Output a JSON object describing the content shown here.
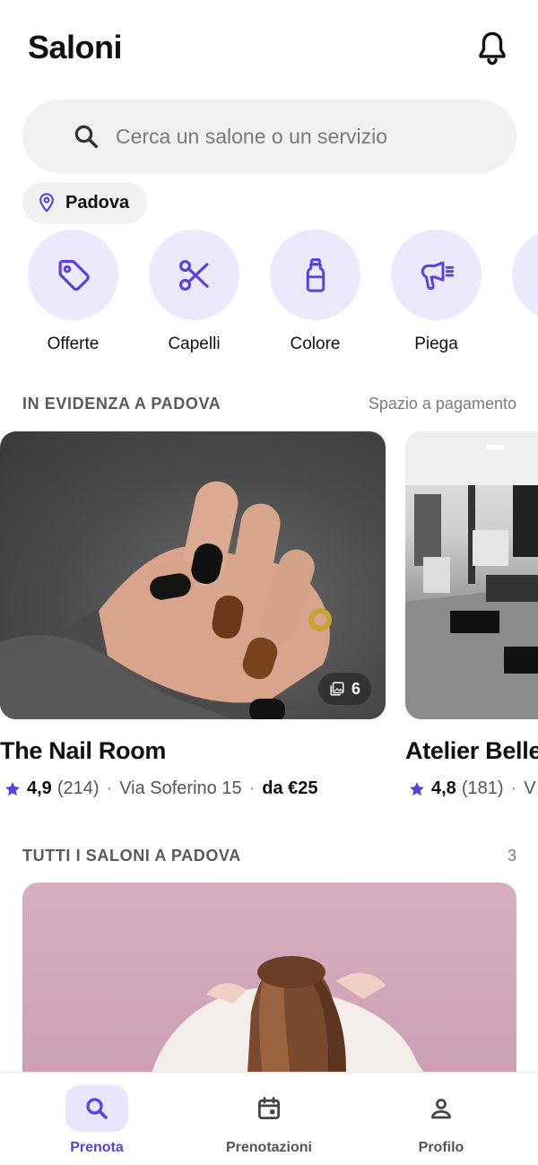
{
  "header": {
    "title": "Saloni",
    "bell_icon": "bell-icon"
  },
  "search": {
    "placeholder": "Cerca un salone o un servizio",
    "icon": "search-icon"
  },
  "location": {
    "city": "Padova",
    "icon": "map-pin-icon"
  },
  "categories": [
    {
      "label": "Offerte",
      "icon": "tag-icon"
    },
    {
      "label": "Capelli",
      "icon": "scissors-icon"
    },
    {
      "label": "Colore",
      "icon": "bottle-icon"
    },
    {
      "label": "Piega",
      "icon": "hair-dryer-icon"
    }
  ],
  "featured": {
    "title": "IN EVIDENZA A PADOVA",
    "sponsored_label": "Spazio a pagamento",
    "salons": [
      {
        "name": "The Nail Room",
        "rating": "4,9",
        "reviews": "(214)",
        "address": "Via Soferino 15",
        "price": "da €25",
        "photo_count": "6"
      },
      {
        "name": "Atelier Belle",
        "rating": "4,8",
        "reviews": "(181)",
        "address": "V"
      }
    ]
  },
  "all_salons": {
    "title": "TUTTI I SALONI A PADOVA",
    "count": "3"
  },
  "bottom_nav": [
    {
      "label": "Prenota",
      "icon": "search-icon",
      "active": true
    },
    {
      "label": "Prenotazioni",
      "icon": "calendar-icon",
      "active": false
    },
    {
      "label": "Profilo",
      "icon": "user-icon",
      "active": false
    }
  ],
  "colors": {
    "accent": "#5b3fe0",
    "accent_light": "#ece9fd",
    "chip_bg": "#f1f1f2"
  }
}
